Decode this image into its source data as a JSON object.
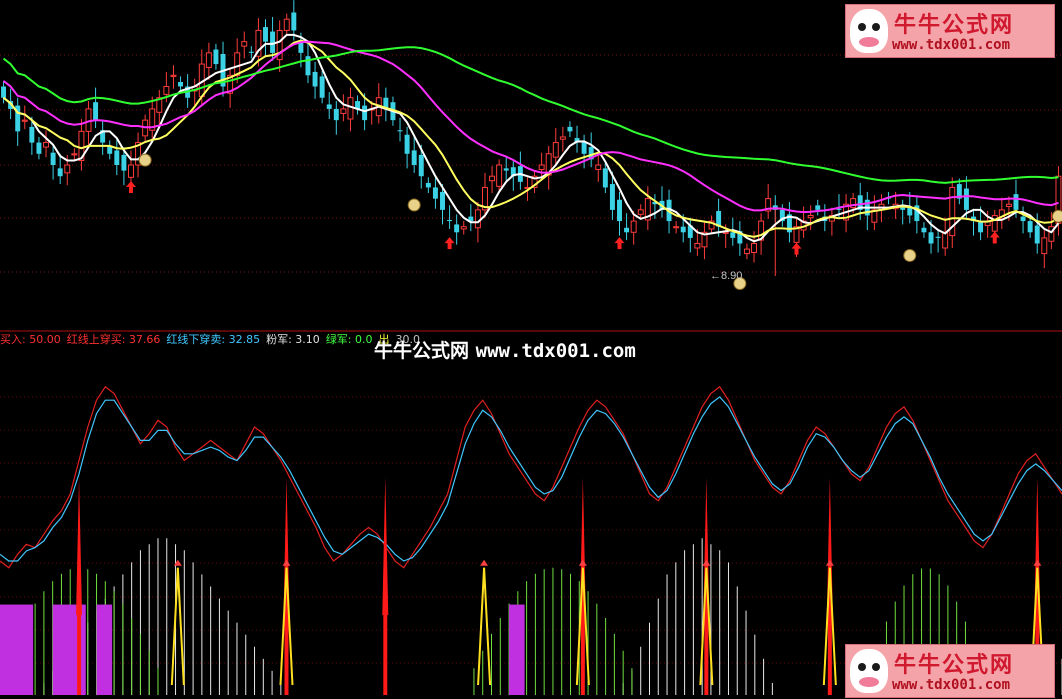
{
  "watermark": {
    "brand": "牛牛公式网",
    "url": "www.tdx001.com"
  },
  "center_watermark": {
    "brand": "牛牛公式网",
    "url": "www.tdx001.com"
  },
  "indicator_legend": [
    {
      "label": "买入: 50.00",
      "color": "#ff3030"
    },
    {
      "label": "红线上穿买: 37.66",
      "color": "#ff3030"
    },
    {
      "label": "红线下穿卖: 32.85",
      "color": "#40c8ff"
    },
    {
      "label": "粉军: 3.10",
      "color": "#e0e0e0"
    },
    {
      "label": "绿军: 0.0",
      "color": "#40ff40"
    },
    {
      "label": "出",
      "color": "#ffff40"
    },
    {
      "label": "30.0",
      "color": "#c0c0c0"
    }
  ],
  "price_panel": {
    "low_marker_label": "8.90"
  },
  "chart_data": [
    {
      "type": "candlestick",
      "panel": "price",
      "ylim": [
        8.6,
        11.4
      ],
      "x_count": 150,
      "closes": [
        10.6,
        10.5,
        10.3,
        10.4,
        10.2,
        10.1,
        10.2,
        10.0,
        9.9,
        10.0,
        10.1,
        10.3,
        10.5,
        10.4,
        10.2,
        10.1,
        10.0,
        9.95,
        10.0,
        10.2,
        10.4,
        10.5,
        10.6,
        10.7,
        10.8,
        10.7,
        10.6,
        10.7,
        10.9,
        11.0,
        10.9,
        10.7,
        10.8,
        11.0,
        11.1,
        11.0,
        11.2,
        11.1,
        11.0,
        11.2,
        11.3,
        11.2,
        11.0,
        10.8,
        10.7,
        10.6,
        10.5,
        10.4,
        10.5,
        10.6,
        10.5,
        10.4,
        10.5,
        10.6,
        10.5,
        10.4,
        10.3,
        10.1,
        10.0,
        9.9,
        9.8,
        9.7,
        9.6,
        9.5,
        9.4,
        9.45,
        9.5,
        9.6,
        9.8,
        9.9,
        10.0,
        9.95,
        9.9,
        9.85,
        9.8,
        9.9,
        10.0,
        10.1,
        10.2,
        10.25,
        10.3,
        10.2,
        10.1,
        10.05,
        10.0,
        9.8,
        9.6,
        9.5,
        9.4,
        9.5,
        9.6,
        9.7,
        9.65,
        9.6,
        9.5,
        9.45,
        9.4,
        9.35,
        9.3,
        9.4,
        9.5,
        9.45,
        9.4,
        9.35,
        9.3,
        9.25,
        9.3,
        9.5,
        9.7,
        9.6,
        9.5,
        9.4,
        9.45,
        9.5,
        9.55,
        9.6,
        9.5,
        9.55,
        9.6,
        9.65,
        9.7,
        9.6,
        9.55,
        9.6,
        9.65,
        9.7,
        9.65,
        9.6,
        9.55,
        9.5,
        9.4,
        9.3,
        9.35,
        9.4,
        9.8,
        9.7,
        9.6,
        9.5,
        9.4,
        9.5,
        9.55,
        9.6,
        9.65,
        9.6,
        9.5,
        9.4,
        9.3,
        9.35,
        9.45,
        9.9
      ],
      "series": [
        {
          "name": "",
          "color": "#ffffff",
          "period": 5
        },
        {
          "name": "",
          "color": "#ffff60",
          "period": 10
        },
        {
          "name": "",
          "color": "#ff30ff",
          "period": 20
        },
        {
          "name": "",
          "color": "#30ff30",
          "period": 40
        }
      ],
      "buy_arrows": [
        18,
        63,
        87,
        112,
        140
      ],
      "money_bags": [
        20,
        58,
        104,
        128,
        149
      ],
      "low_marker_index": 109
    },
    {
      "type": "line",
      "panel": "indicator",
      "ylim": [
        0,
        100
      ],
      "series": [
        {
          "name": "",
          "color": "#e02020",
          "values": [
            40,
            38,
            42,
            45,
            44,
            48,
            52,
            55,
            60,
            70,
            80,
            88,
            92,
            90,
            85,
            80,
            75,
            78,
            82,
            80,
            74,
            70,
            72,
            74,
            76,
            74,
            72,
            70,
            75,
            80,
            78,
            74,
            70,
            65,
            60,
            55,
            50,
            44,
            40,
            42,
            45,
            48,
            50,
            48,
            44,
            40,
            38,
            42,
            46,
            50,
            55,
            60,
            70,
            80,
            85,
            88,
            84,
            78,
            72,
            68,
            64,
            60,
            58,
            62,
            68,
            74,
            80,
            85,
            88,
            86,
            82,
            78,
            72,
            66,
            60,
            58,
            62,
            68,
            74,
            80,
            86,
            90,
            92,
            88,
            82,
            76,
            70,
            66,
            62,
            60,
            64,
            70,
            76,
            80,
            78,
            74,
            70,
            66,
            64,
            68,
            74,
            80,
            84,
            86,
            82,
            76,
            70,
            64,
            58,
            54,
            50,
            46,
            44,
            48,
            54,
            60,
            66,
            70,
            72,
            68,
            64,
            60
          ]
        },
        {
          "name": "",
          "color": "#40c8ff",
          "values": [
            42,
            40,
            40,
            43,
            44,
            46,
            50,
            53,
            58,
            66,
            76,
            84,
            88,
            88,
            84,
            80,
            76,
            76,
            79,
            79,
            75,
            72,
            72,
            73,
            74,
            73,
            71,
            70,
            73,
            77,
            77,
            74,
            71,
            67,
            62,
            57,
            52,
            47,
            43,
            42,
            44,
            46,
            48,
            47,
            45,
            42,
            40,
            41,
            44,
            48,
            52,
            57,
            66,
            75,
            81,
            85,
            83,
            79,
            74,
            70,
            66,
            62,
            60,
            61,
            65,
            71,
            77,
            82,
            85,
            84,
            81,
            77,
            72,
            67,
            62,
            59,
            61,
            66,
            72,
            78,
            83,
            87,
            89,
            86,
            81,
            76,
            71,
            67,
            63,
            61,
            63,
            68,
            74,
            78,
            77,
            74,
            70,
            67,
            65,
            67,
            72,
            77,
            81,
            83,
            81,
            76,
            71,
            65,
            60,
            56,
            52,
            48,
            46,
            48,
            53,
            58,
            63,
            67,
            69,
            67,
            64,
            61
          ]
        }
      ],
      "red_spikes": [
        16,
        58,
        78,
        118,
        143,
        168,
        210
      ],
      "yellow_spikes": [
        36,
        58,
        98,
        118,
        143,
        168,
        210
      ],
      "white_hump": [
        0,
        0,
        0,
        0,
        0,
        2,
        4,
        6,
        8,
        10,
        12,
        14,
        16,
        18,
        20,
        22,
        24,
        25,
        26,
        26,
        25,
        24,
        22,
        20,
        18,
        16,
        14,
        12,
        10,
        8,
        6,
        4,
        2,
        0,
        0,
        0,
        0,
        0,
        0,
        0,
        0,
        0,
        0,
        0,
        0,
        0,
        0,
        0,
        0,
        0,
        0,
        0,
        0,
        0,
        0,
        0,
        0,
        0,
        0,
        0,
        0,
        0,
        0,
        0,
        0,
        0,
        0,
        0,
        0,
        0,
        0,
        2,
        4,
        8,
        12,
        16,
        20,
        22,
        24,
        25,
        26,
        25,
        24,
        22,
        18,
        14,
        10,
        6,
        2,
        0,
        0,
        0,
        0,
        0,
        0,
        0,
        0,
        0,
        0,
        0,
        0,
        0,
        0,
        0,
        0,
        0,
        0,
        0,
        0,
        0,
        0,
        0,
        0,
        0,
        0,
        0,
        0,
        0,
        0,
        2,
        4,
        6,
        8,
        10,
        12
      ]
    }
  ]
}
